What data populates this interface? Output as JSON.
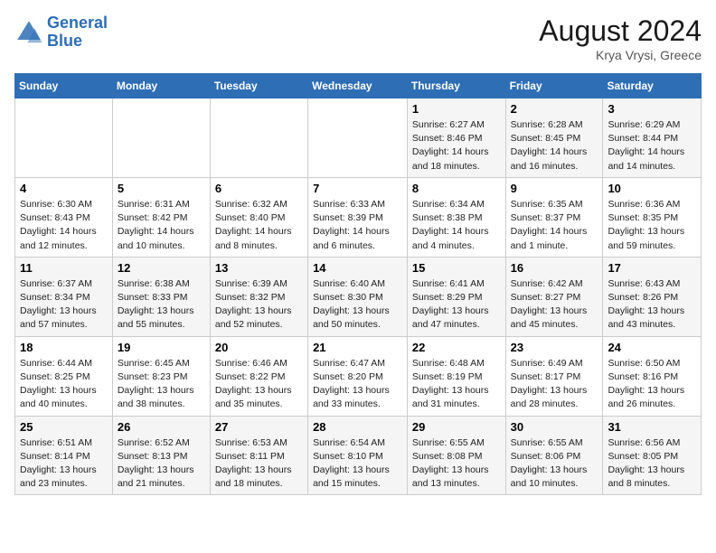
{
  "header": {
    "logo_line1": "General",
    "logo_line2": "Blue",
    "month_year": "August 2024",
    "location": "Krya Vrysi, Greece"
  },
  "days_of_week": [
    "Sunday",
    "Monday",
    "Tuesday",
    "Wednesday",
    "Thursday",
    "Friday",
    "Saturday"
  ],
  "weeks": [
    {
      "days": [
        {
          "num": "",
          "info": ""
        },
        {
          "num": "",
          "info": ""
        },
        {
          "num": "",
          "info": ""
        },
        {
          "num": "",
          "info": ""
        },
        {
          "num": "1",
          "info": "Sunrise: 6:27 AM\nSunset: 8:46 PM\nDaylight: 14 hours\nand 18 minutes."
        },
        {
          "num": "2",
          "info": "Sunrise: 6:28 AM\nSunset: 8:45 PM\nDaylight: 14 hours\nand 16 minutes."
        },
        {
          "num": "3",
          "info": "Sunrise: 6:29 AM\nSunset: 8:44 PM\nDaylight: 14 hours\nand 14 minutes."
        }
      ]
    },
    {
      "days": [
        {
          "num": "4",
          "info": "Sunrise: 6:30 AM\nSunset: 8:43 PM\nDaylight: 14 hours\nand 12 minutes."
        },
        {
          "num": "5",
          "info": "Sunrise: 6:31 AM\nSunset: 8:42 PM\nDaylight: 14 hours\nand 10 minutes."
        },
        {
          "num": "6",
          "info": "Sunrise: 6:32 AM\nSunset: 8:40 PM\nDaylight: 14 hours\nand 8 minutes."
        },
        {
          "num": "7",
          "info": "Sunrise: 6:33 AM\nSunset: 8:39 PM\nDaylight: 14 hours\nand 6 minutes."
        },
        {
          "num": "8",
          "info": "Sunrise: 6:34 AM\nSunset: 8:38 PM\nDaylight: 14 hours\nand 4 minutes."
        },
        {
          "num": "9",
          "info": "Sunrise: 6:35 AM\nSunset: 8:37 PM\nDaylight: 14 hours\nand 1 minute."
        },
        {
          "num": "10",
          "info": "Sunrise: 6:36 AM\nSunset: 8:35 PM\nDaylight: 13 hours\nand 59 minutes."
        }
      ]
    },
    {
      "days": [
        {
          "num": "11",
          "info": "Sunrise: 6:37 AM\nSunset: 8:34 PM\nDaylight: 13 hours\nand 57 minutes."
        },
        {
          "num": "12",
          "info": "Sunrise: 6:38 AM\nSunset: 8:33 PM\nDaylight: 13 hours\nand 55 minutes."
        },
        {
          "num": "13",
          "info": "Sunrise: 6:39 AM\nSunset: 8:32 PM\nDaylight: 13 hours\nand 52 minutes."
        },
        {
          "num": "14",
          "info": "Sunrise: 6:40 AM\nSunset: 8:30 PM\nDaylight: 13 hours\nand 50 minutes."
        },
        {
          "num": "15",
          "info": "Sunrise: 6:41 AM\nSunset: 8:29 PM\nDaylight: 13 hours\nand 47 minutes."
        },
        {
          "num": "16",
          "info": "Sunrise: 6:42 AM\nSunset: 8:27 PM\nDaylight: 13 hours\nand 45 minutes."
        },
        {
          "num": "17",
          "info": "Sunrise: 6:43 AM\nSunset: 8:26 PM\nDaylight: 13 hours\nand 43 minutes."
        }
      ]
    },
    {
      "days": [
        {
          "num": "18",
          "info": "Sunrise: 6:44 AM\nSunset: 8:25 PM\nDaylight: 13 hours\nand 40 minutes."
        },
        {
          "num": "19",
          "info": "Sunrise: 6:45 AM\nSunset: 8:23 PM\nDaylight: 13 hours\nand 38 minutes."
        },
        {
          "num": "20",
          "info": "Sunrise: 6:46 AM\nSunset: 8:22 PM\nDaylight: 13 hours\nand 35 minutes."
        },
        {
          "num": "21",
          "info": "Sunrise: 6:47 AM\nSunset: 8:20 PM\nDaylight: 13 hours\nand 33 minutes."
        },
        {
          "num": "22",
          "info": "Sunrise: 6:48 AM\nSunset: 8:19 PM\nDaylight: 13 hours\nand 31 minutes."
        },
        {
          "num": "23",
          "info": "Sunrise: 6:49 AM\nSunset: 8:17 PM\nDaylight: 13 hours\nand 28 minutes."
        },
        {
          "num": "24",
          "info": "Sunrise: 6:50 AM\nSunset: 8:16 PM\nDaylight: 13 hours\nand 26 minutes."
        }
      ]
    },
    {
      "days": [
        {
          "num": "25",
          "info": "Sunrise: 6:51 AM\nSunset: 8:14 PM\nDaylight: 13 hours\nand 23 minutes."
        },
        {
          "num": "26",
          "info": "Sunrise: 6:52 AM\nSunset: 8:13 PM\nDaylight: 13 hours\nand 21 minutes."
        },
        {
          "num": "27",
          "info": "Sunrise: 6:53 AM\nSunset: 8:11 PM\nDaylight: 13 hours\nand 18 minutes."
        },
        {
          "num": "28",
          "info": "Sunrise: 6:54 AM\nSunset: 8:10 PM\nDaylight: 13 hours\nand 15 minutes."
        },
        {
          "num": "29",
          "info": "Sunrise: 6:55 AM\nSunset: 8:08 PM\nDaylight: 13 hours\nand 13 minutes."
        },
        {
          "num": "30",
          "info": "Sunrise: 6:55 AM\nSunset: 8:06 PM\nDaylight: 13 hours\nand 10 minutes."
        },
        {
          "num": "31",
          "info": "Sunrise: 6:56 AM\nSunset: 8:05 PM\nDaylight: 13 hours\nand 8 minutes."
        }
      ]
    }
  ]
}
